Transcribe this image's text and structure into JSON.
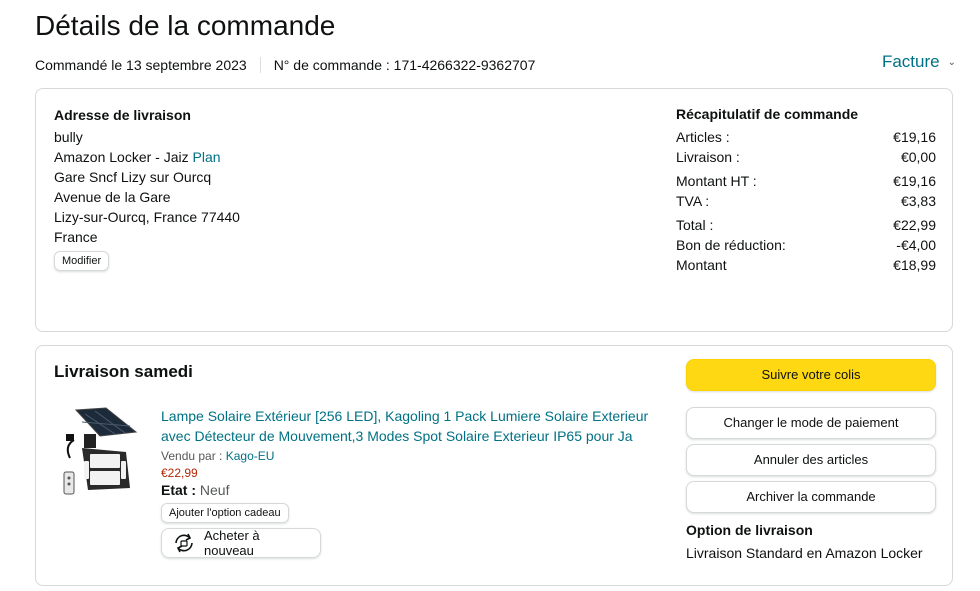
{
  "page": {
    "title": "Détails de la commande"
  },
  "meta": {
    "ordered": "Commandé le 13 septembre 2023",
    "order_number": "N° de commande : 171-4266322-9362707"
  },
  "invoice": {
    "label": "Facture"
  },
  "shipping": {
    "heading": "Adresse de livraison",
    "name": "bully",
    "locker": "Amazon Locker - Jaiz",
    "plan_link": "Plan",
    "line2": "Gare Sncf Lizy sur Ourcq",
    "line3": "Avenue de la Gare",
    "line4": "Lizy-sur-Ourcq, France 77440",
    "country": "France",
    "edit_button": "Modifier"
  },
  "summary": {
    "heading": "Récapitulatif de commande",
    "rows": [
      {
        "label": "Articles :",
        "value": "€19,16"
      },
      {
        "label": "Livraison :",
        "value": "€0,00"
      },
      {
        "label": "Montant HT :",
        "value": "€19,16"
      },
      {
        "label": "TVA :",
        "value": "€3,83"
      },
      {
        "label": "Total :",
        "value": "€22,99"
      },
      {
        "label": "Bon de réduction:",
        "value": "-€4,00"
      },
      {
        "label": "Montant",
        "value": "€18,99"
      }
    ]
  },
  "delivery": {
    "heading": "Livraison samedi",
    "product": {
      "title": "Lampe Solaire Extérieur [256 LED], Kagoling 1 Pack Lumiere Solaire Exterieur avec Détecteur de Mouvement,3 Modes Spot Solaire Exterieur IP65 pour Ja",
      "sold_by_label": "Vendu par :",
      "seller": "Kago-EU",
      "price": "€22,99",
      "condition_label": "Etat :",
      "condition": "Neuf",
      "gift_button": "Ajouter l'option cadeau",
      "buy_again_button": "Acheter à nouveau"
    },
    "actions": {
      "track": "Suivre votre colis",
      "change_payment": "Changer le mode de paiement",
      "cancel": "Annuler des articles",
      "archive": "Archiver la commande"
    },
    "option": {
      "heading": "Option de livraison",
      "value": "Livraison Standard en Amazon Locker"
    }
  },
  "colors": {
    "link": "#007185",
    "price": "#b12704",
    "primary_button": "#ffd814",
    "border": "#d5d9d9"
  }
}
